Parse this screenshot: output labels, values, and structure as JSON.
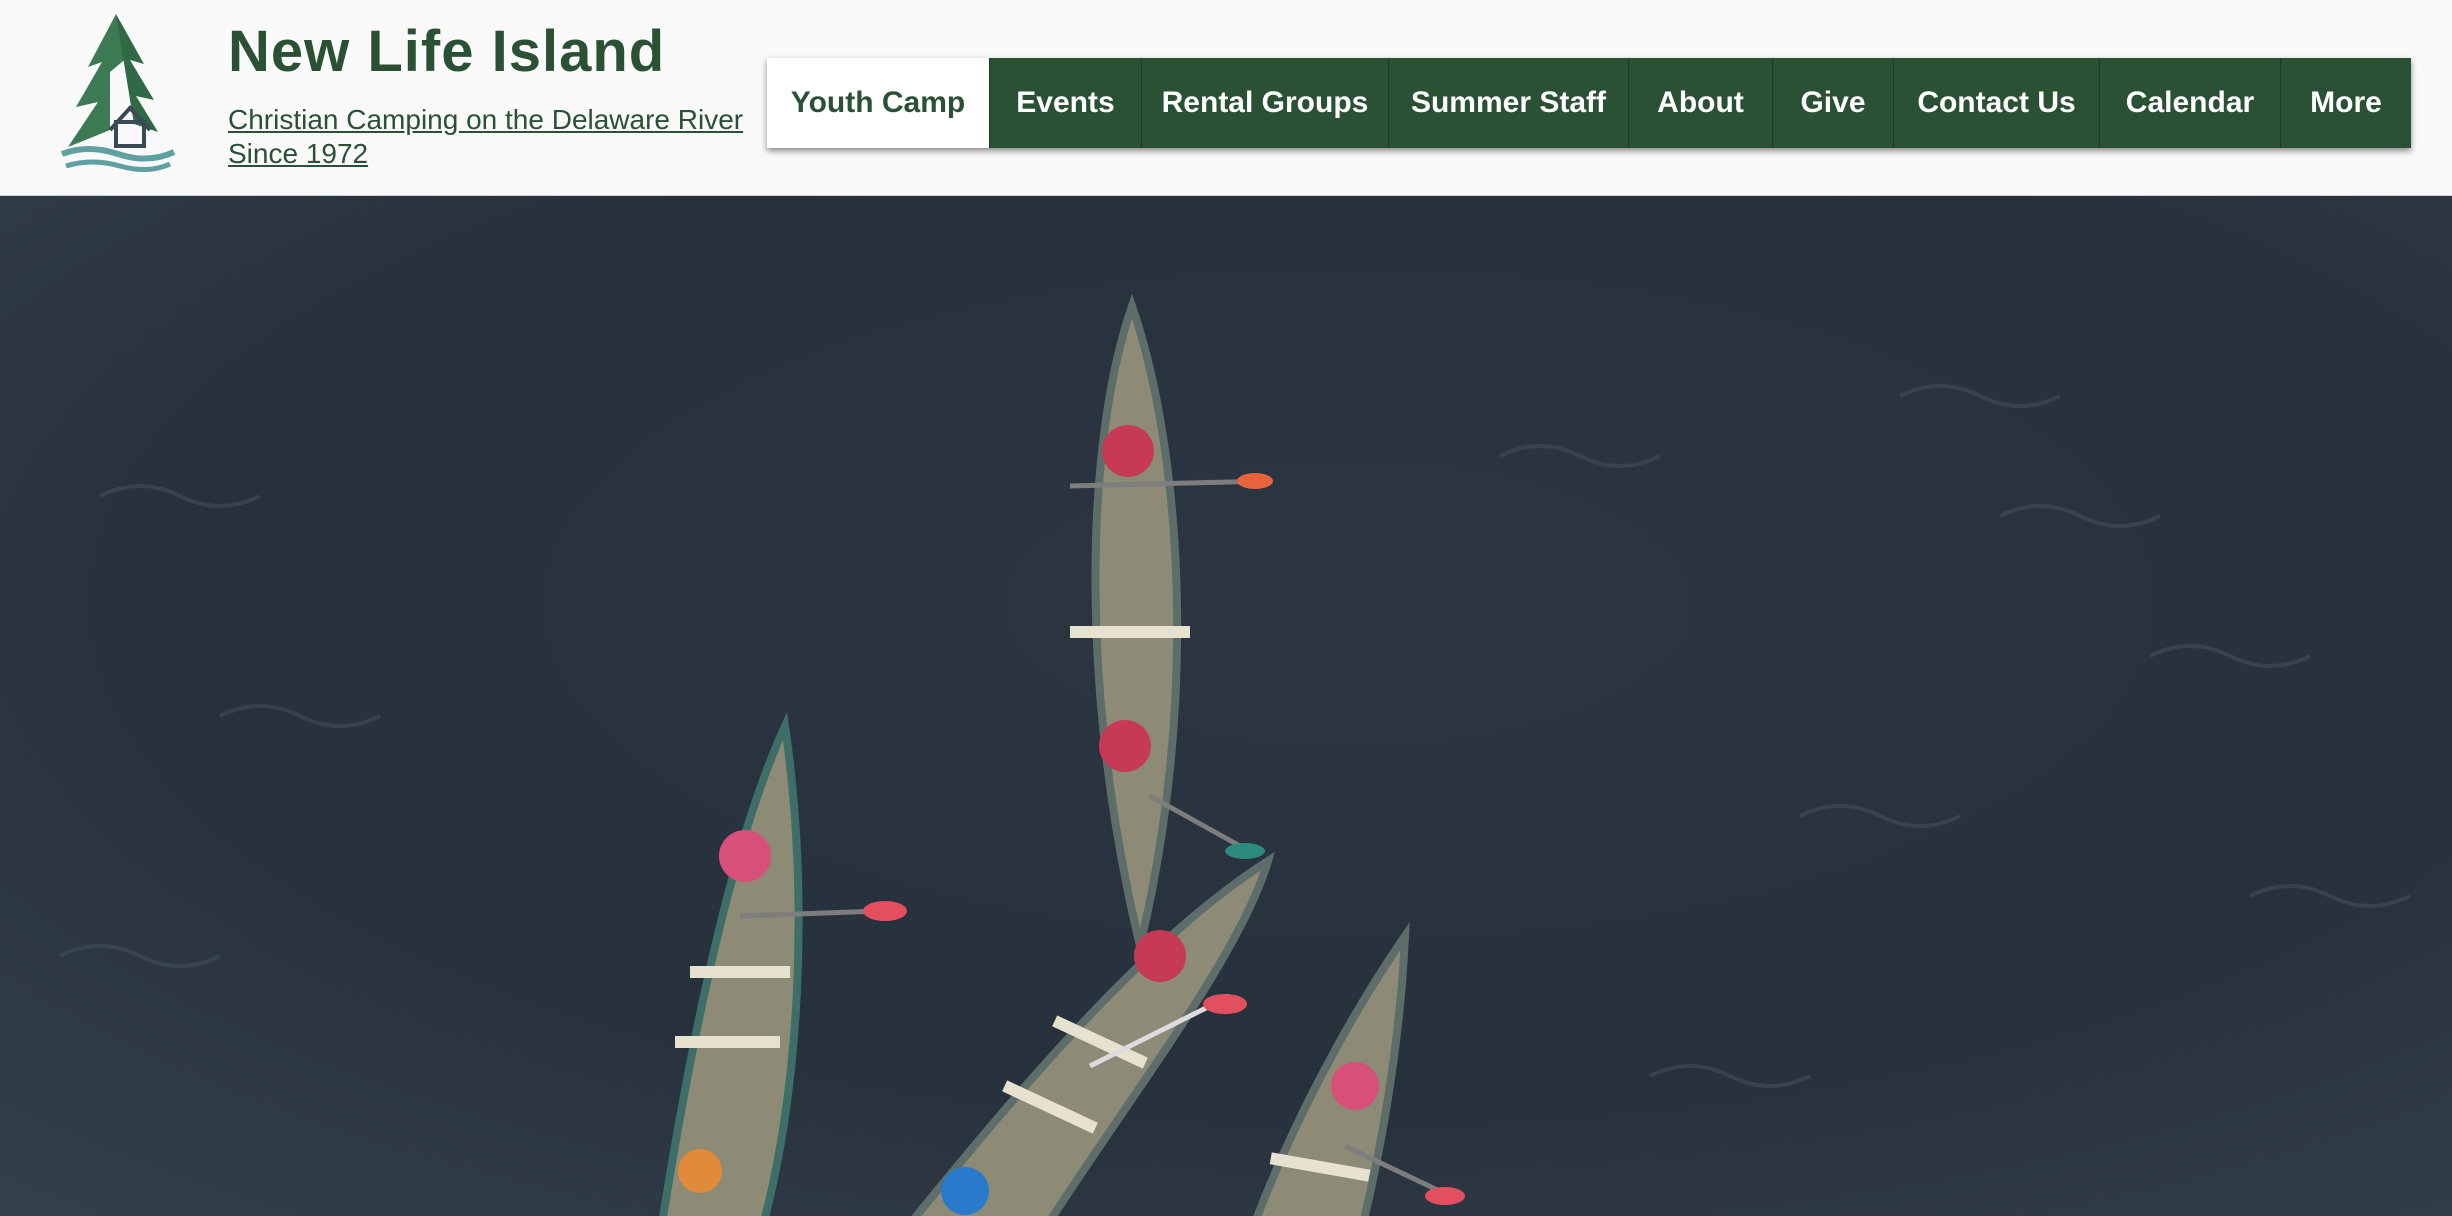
{
  "site": {
    "title": "New Life Island",
    "tagline_line1": "Christian Camping on the Delaware River",
    "tagline_line2": "Since 1972"
  },
  "nav": {
    "items": [
      {
        "label": "Youth Camp",
        "active": true
      },
      {
        "label": "Events"
      },
      {
        "label": "Rental Groups"
      },
      {
        "label": "Summer Staff"
      },
      {
        "label": "About"
      },
      {
        "label": "Give"
      },
      {
        "label": "Contact Us"
      },
      {
        "label": "Calendar"
      },
      {
        "label": "More"
      }
    ]
  },
  "hero": {
    "subject": "canoes",
    "canoe_count": 4
  },
  "colors": {
    "brand_green": "#2b5135",
    "header_bg": "#f9f9f9",
    "water": "#2a3441"
  },
  "icons": {
    "logo": "pine-tree-house-waves-logo-icon"
  }
}
